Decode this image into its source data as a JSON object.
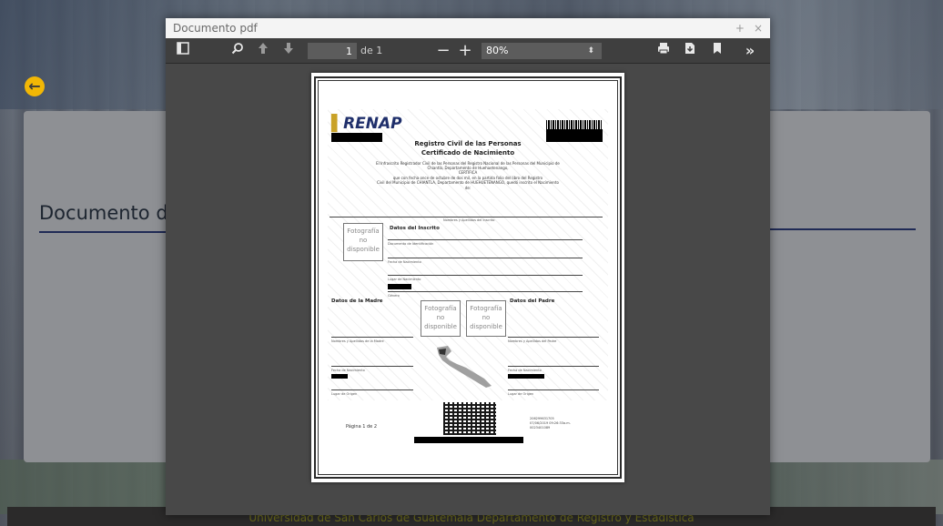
{
  "background": {
    "page_title_partial": "Documento d",
    "footer_text": "Universidad de San Carlos de Guatemala Departamento de Registro y Estadística"
  },
  "dialog": {
    "title": "Documento pdf",
    "actions": {
      "maximize": "+",
      "close": "×"
    }
  },
  "toolbar": {
    "page_value": "1",
    "page_of": "de 1",
    "zoom_out": "−",
    "zoom_in": "+",
    "zoom_value": "80%"
  },
  "pdf": {
    "logo": "RENAP",
    "title": "Registro Civil de las Personas",
    "subtitle": "Certificado de Nacimiento",
    "intro_line1": "El Infrascrito Registrador Civil de las Personas del Registro Nacional de las Personas del Municipio de",
    "intro_line2": "Chiantla, Departamento de Huehuetenango,",
    "certifica": "CERTIFICA",
    "intro_line3": "que con fecha once de octubre de dos mil, en la partida        folio        del libro        del Registro",
    "intro_line4": "Civil del Municipio de CHIANTLA, Departamento de HUEHUETENANGO, quedó inscrito el Nacimiento",
    "intro_line5": "de:",
    "names_label": "Nombres y Apellidos del Inscrito",
    "datos_inscrito": "Datos del Inscrito",
    "doc_label": "Documento de Identificación",
    "fecha_nac_label": "Fecha de Nacimiento",
    "lugar_nac_label": "Lugar de Nacimiento",
    "sexo_label": "Género",
    "datos_madre": "Datos de la Madre",
    "datos_padre": "Datos del Padre",
    "photo_text": "Fotografía no disponible",
    "madre_names_label": "Nombres y Apellidos de la Madre",
    "padre_names_label": "Nombres y Apellidos del Padre",
    "madre_fecha_label": "Fecha de Nacimiento",
    "padre_fecha_label": "Fecha de Nacimiento",
    "madre_lugar_label": "Lugar de Origen",
    "padre_lugar_label": "Lugar de Origen",
    "page_label": "Página 1 de 2",
    "id_line1": "206299631705",
    "id_line2": "07/06/2019          09:26:33a.m.",
    "id_line3": "0023401089"
  }
}
